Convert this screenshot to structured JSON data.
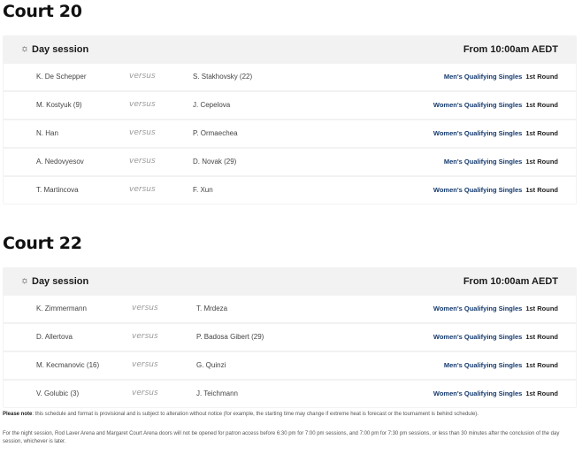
{
  "courts": [
    {
      "title": "Court 20",
      "session": {
        "label": "Day session",
        "time": "From 10:00am AEDT",
        "icon": "sun-icon"
      },
      "matches": [
        {
          "player1": "K. De Schepper",
          "versus": "versus",
          "player2": "S. Stakhovsky (22)",
          "event": "Men's Qualifying Singles",
          "round": "1st Round"
        },
        {
          "player1": "M. Kostyuk (9)",
          "versus": "versus",
          "player2": "J. Cepelova",
          "event": "Women's Qualifying Singles",
          "round": "1st Round"
        },
        {
          "player1": "N. Han",
          "versus": "versus",
          "player2": "P. Ormaechea",
          "event": "Women's Qualifying Singles",
          "round": "1st Round"
        },
        {
          "player1": "A. Nedovyesov",
          "versus": "versus",
          "player2": "D. Novak (29)",
          "event": "Men's Qualifying Singles",
          "round": "1st Round"
        },
        {
          "player1": "T. Martincova",
          "versus": "versus",
          "player2": "F. Xun",
          "event": "Women's Qualifying Singles",
          "round": "1st Round"
        }
      ]
    },
    {
      "title": "Court 22",
      "session": {
        "label": "Day session",
        "time": "From 10:00am AEDT",
        "icon": "sun-icon"
      },
      "matches": [
        {
          "player1": "K. Zimmermann",
          "versus": "versus",
          "player2": "T. Mrdeza",
          "event": "Women's Qualifying Singles",
          "round": "1st Round"
        },
        {
          "player1": "D. Allertova",
          "versus": "versus",
          "player2": "P. Badosa Gibert (29)",
          "event": "Women's Qualifying Singles",
          "round": "1st Round"
        },
        {
          "player1": "M. Kecmanovic (16)",
          "versus": "versus",
          "player2": "G. Quinzi",
          "event": "Men's Qualifying Singles",
          "round": "1st Round"
        },
        {
          "player1": "V. Golubic (3)",
          "versus": "versus",
          "player2": "J. Teichmann",
          "event": "Women's Qualifying Singles",
          "round": "1st Round"
        }
      ]
    }
  ],
  "notes": {
    "label": "Please note",
    "text": ": this schedule and format is provisional and is subject to alteration without notice (for example, the starting time may change if extreme heat is forecast or the tournament is behind schedule).",
    "night": "For the night session, Rod Laver Arena and Margaret Court Arena doors will not be opened for patron access before 6:30 pm for 7:00 pm sessions, and 7:00 pm for 7:30 pm sessions, or less than 30 minutes after the conclusion of the day session, whichever is later."
  },
  "colors": {
    "event_link": "#143a6e",
    "panel_bg": "#f2f2f2",
    "versus": "#9a9a9a"
  }
}
